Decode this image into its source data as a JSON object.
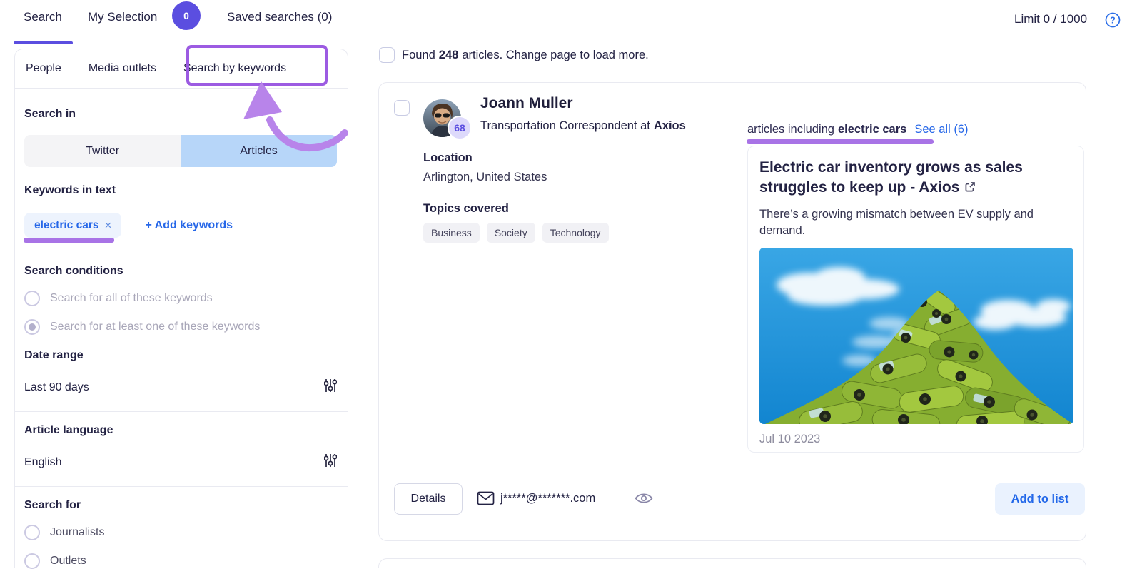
{
  "colors": {
    "accent_purple": "#5b4ee0",
    "annotation_purple": "#a873e6",
    "annotation_box_purple": "#9c5be2",
    "link_blue": "#2667e8",
    "toggle_selected_blue": "#b7d6f9",
    "add_button_bg": "#eaf2fe"
  },
  "icons": {
    "help": "?",
    "close": "×",
    "external_link": "arrow-out-of-box",
    "mail": "envelope",
    "eye": "eye-outline",
    "sliders": "vertical-sliders"
  },
  "top_nav": {
    "search_label": "Search",
    "my_selection_label": "My Selection",
    "my_selection_badge": "0",
    "saved_searches_label": "Saved searches (0)",
    "limit_label": "Limit 0 / 1000"
  },
  "sidebar": {
    "tabs": [
      "People",
      "Media outlets",
      "Search by keywords"
    ],
    "search_in": {
      "label": "Search in",
      "options": [
        "Twitter",
        "Articles"
      ],
      "selected": "Articles"
    },
    "keywords": {
      "label": "Keywords in text",
      "chip": "electric cars",
      "add_label": "+ Add keywords"
    },
    "conditions": {
      "label": "Search conditions",
      "options": [
        "Search for all of these keywords",
        "Search for at least one of these keywords"
      ],
      "selected_index": 1
    },
    "date_range": {
      "label": "Date range",
      "value": "Last 90 days"
    },
    "language": {
      "label": "Article language",
      "value": "English"
    },
    "search_for": {
      "label": "Search for",
      "options": [
        "Journalists",
        "Outlets"
      ]
    }
  },
  "results": {
    "found_prefix": "Found",
    "count": "248",
    "found_suffix": "articles. Change page to load more."
  },
  "person": {
    "name": "Joann Muller",
    "role_prefix": "Transportation Correspondent at",
    "company": "Axios",
    "score": "68",
    "location_label": "Location",
    "location": "Arlington, United States",
    "topics_label": "Topics covered",
    "topics": [
      "Business",
      "Society",
      "Technology"
    ],
    "details_label": "Details",
    "email": "j*****@*******.com",
    "add_to_list_label": "Add to list"
  },
  "articles_panel": {
    "heading_prefix": "articles including",
    "heading_keyword": "electric cars",
    "see_all_label": "See all (6)",
    "article": {
      "title": "Electric car inventory grows as sales struggles to keep up - Axios",
      "description": "There’s a growing mismatch between EV supply and demand.",
      "date": "Jul 10 2023"
    }
  }
}
